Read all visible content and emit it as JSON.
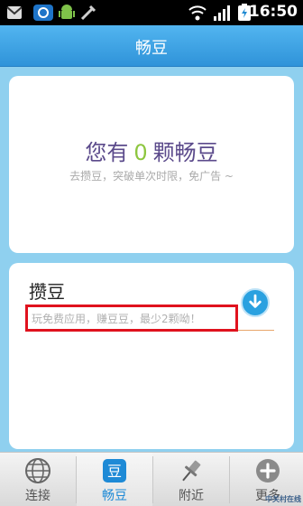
{
  "status_bar": {
    "time": "16:50"
  },
  "header": {
    "title": "畅豆"
  },
  "bean_card": {
    "prefix": "您有",
    "count": "0",
    "suffix": "颗畅豆",
    "subtitle": "去攒豆，突破单次时限，免广告 ~"
  },
  "earn_card": {
    "title": "攒豆",
    "description": "玩免费应用，赚豆豆，最少2颗呦！"
  },
  "bottom_nav": {
    "tabs": [
      {
        "label": "连接"
      },
      {
        "label": "畅豆"
      },
      {
        "label": "附近"
      },
      {
        "label": "更多"
      }
    ]
  },
  "watermark": "中关村在线",
  "colors": {
    "accent": "#2f93d9",
    "count": "#8dc63f",
    "highlight": "#e0121e"
  }
}
